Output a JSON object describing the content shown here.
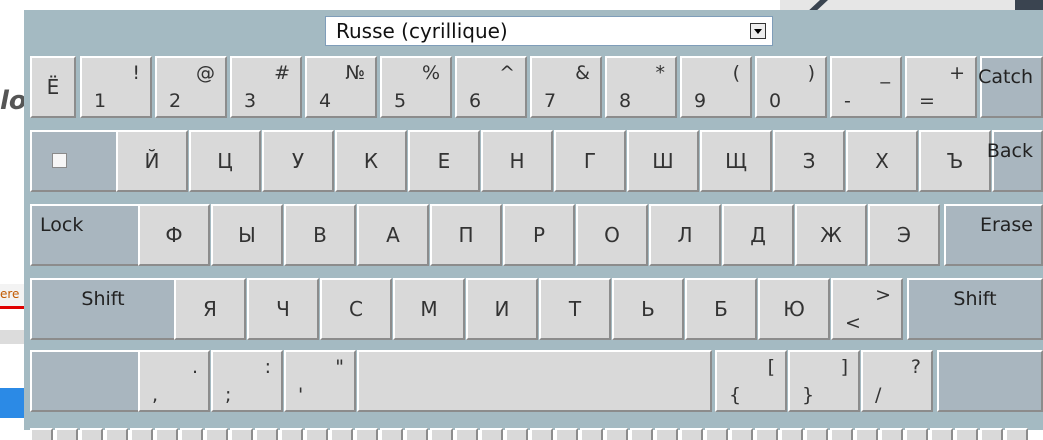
{
  "background": {
    "text_fragment": "lo",
    "link_fragment": "ere"
  },
  "layout_select": {
    "value": "Russe (cyrillique)"
  },
  "rows": {
    "numbers": [
      {
        "main": "Ё"
      },
      {
        "hi": "!",
        "lo": "1"
      },
      {
        "hi": "@",
        "lo": "2"
      },
      {
        "hi": "#",
        "lo": "3"
      },
      {
        "hi": "№",
        "lo": "4"
      },
      {
        "hi": "%",
        "lo": "5"
      },
      {
        "hi": "^",
        "lo": "6"
      },
      {
        "hi": "&",
        "lo": "7"
      },
      {
        "hi": "*",
        "lo": "8"
      },
      {
        "hi": "(",
        "lo": "9"
      },
      {
        "hi": ")",
        "lo": "0"
      },
      {
        "hi": "_",
        "lo": "-"
      },
      {
        "hi": "+",
        "lo": "="
      }
    ],
    "top": [
      "Й",
      "Ц",
      "У",
      "К",
      "Е",
      "Н",
      "Г",
      "Ш",
      "Щ",
      "З",
      "Х",
      "Ъ"
    ],
    "home": [
      "Ф",
      "Ы",
      "В",
      "А",
      "П",
      "Р",
      "О",
      "Л",
      "Д",
      "Ж",
      "Э"
    ],
    "bottom": [
      "Я",
      "Ч",
      "С",
      "М",
      "И",
      "Т",
      "Ь",
      "Б",
      "Ю"
    ],
    "bottom_extra": {
      "hi": ">",
      "lo": "<"
    },
    "space_row": [
      {
        "hi": ".",
        "lo": ","
      },
      {
        "hi": ":",
        "lo": ";"
      },
      {
        "hi": "\"",
        "lo": "'"
      }
    ],
    "space_row_right": [
      {
        "hi": "[",
        "lo": "{"
      },
      {
        "hi": "]",
        "lo": "}"
      },
      {
        "hi": "?",
        "lo": "/"
      }
    ]
  },
  "mod_keys": {
    "catch": "Catch",
    "back": "Back",
    "lock": "Lock",
    "erase": "Erase",
    "shift_left": "Shift",
    "shift_right": "Shift"
  },
  "colors": {
    "panel": "#a4bac2",
    "key": "#d9d9d9",
    "mod_key": "#a9b6bf"
  }
}
